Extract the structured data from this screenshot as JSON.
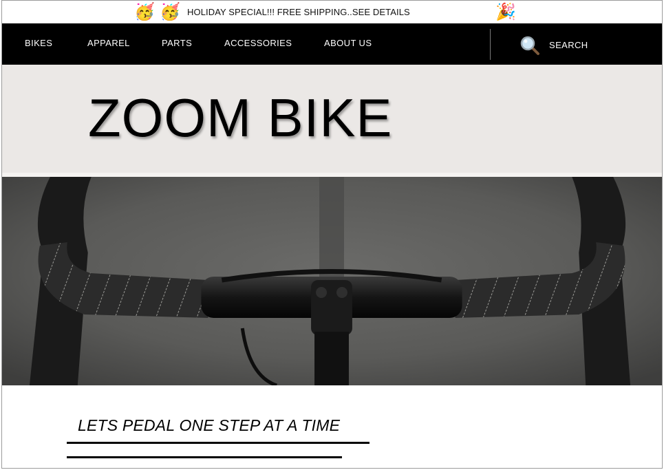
{
  "promo": {
    "text": "HOLIDAY SPECIAL!!! FREE SHIPPING..SEE DETAILS",
    "emoji_left_1": "🥳",
    "emoji_left_2": "🥳",
    "emoji_right": "🎉"
  },
  "nav": {
    "items": [
      "BIKES",
      "APPAREL",
      "PARTS",
      "ACCESSORIES",
      "ABOUT US"
    ],
    "search_label": "SEARCH",
    "search_icon": "magnifying-glass-icon"
  },
  "hero": {
    "brand": "ZOOM BIKE"
  },
  "photo": {
    "subject": "bicycle-handlebar"
  },
  "tagline": "LETS PEDAL ONE STEP AT A TIME",
  "colors": {
    "nav_bg": "#000000",
    "hero_bg": "#ebe8e6",
    "text": "#000000"
  }
}
